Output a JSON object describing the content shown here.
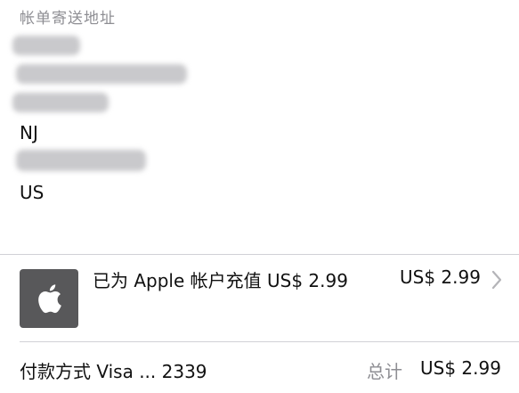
{
  "billing_address": {
    "section_title": "帐单寄送地址",
    "state": "NJ",
    "country": "US"
  },
  "purchase_item": {
    "icon": "apple-logo-icon",
    "tile_color": "#58585a",
    "title": "已为 Apple 帐户充值 US$ 2.99",
    "price": "US$ 2.99",
    "chevron_icon": "chevron-right-icon"
  },
  "footer": {
    "payment_method": "付款方式 Visa ... 2339",
    "total_label": "总计",
    "total_value": "US$ 2.99"
  },
  "colors": {
    "secondary_text": "#8e8e93",
    "divider": "#d1d1d6",
    "primary_text": "#111111"
  }
}
